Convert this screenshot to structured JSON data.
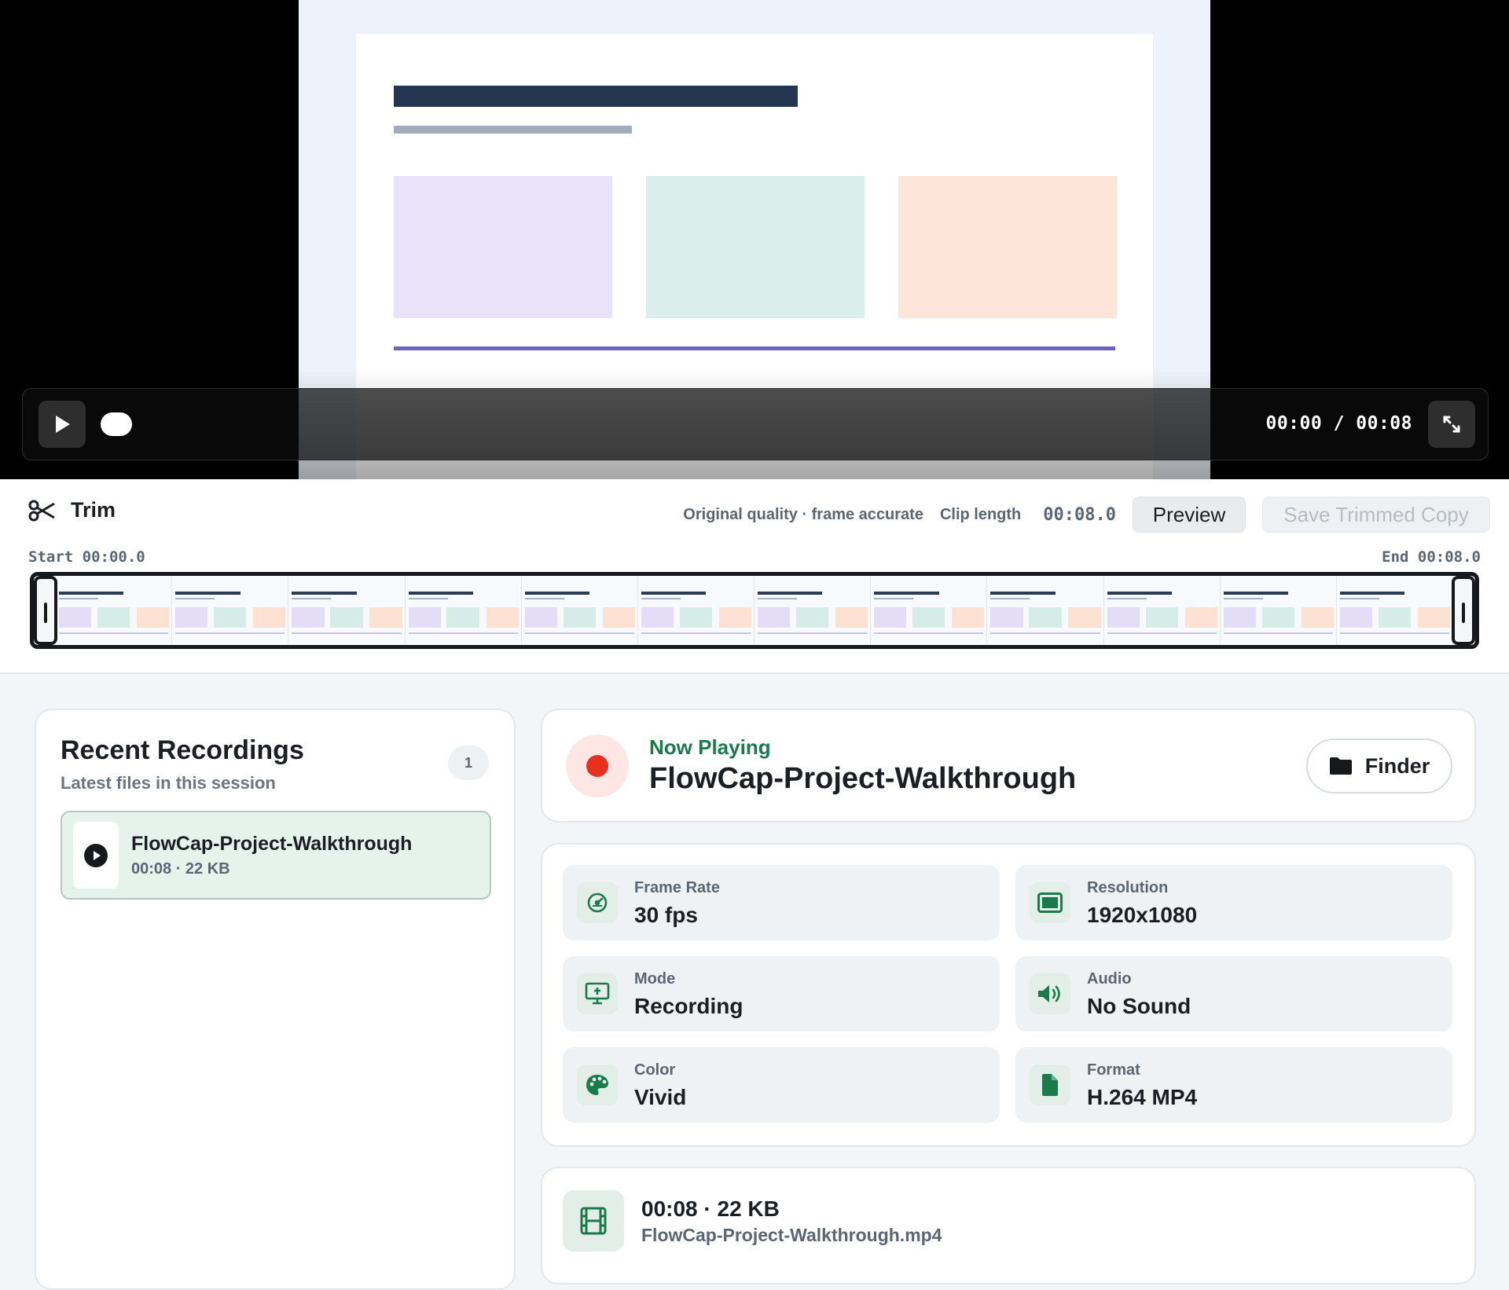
{
  "player": {
    "timecode": "00:00 / 00:08",
    "play_icon": "play-icon",
    "expand_icon": "expand-icon"
  },
  "trim": {
    "title": "Trim",
    "quality": "Original quality · frame accurate",
    "clip_length_label": "Clip length",
    "clip_length": "00:08.0",
    "preview_label": "Preview",
    "save_label": "Save Trimmed Copy",
    "start": "Start 00:00.0",
    "end": "End 00:08.0",
    "thumbnail_count": 12
  },
  "recent": {
    "title": "Recent Recordings",
    "subtitle": "Latest files in this session",
    "count": "1",
    "items": [
      {
        "name": "FlowCap-Project-Walkthrough",
        "meta": "00:08 · 22 KB"
      }
    ]
  },
  "now_playing": {
    "label": "Now Playing",
    "title": "FlowCap-Project-Walkthrough",
    "finder_label": "Finder"
  },
  "specs": [
    {
      "label": "Frame Rate",
      "value": "30 fps",
      "icon": "gauge-icon"
    },
    {
      "label": "Resolution",
      "value": "1920x1080",
      "icon": "screen-icon"
    },
    {
      "label": "Mode",
      "value": "Recording",
      "icon": "monitor-icon"
    },
    {
      "label": "Audio",
      "value": "No Sound",
      "icon": "speaker-icon"
    },
    {
      "label": "Color",
      "value": "Vivid",
      "icon": "palette-icon"
    },
    {
      "label": "Format",
      "value": "H.264 MP4",
      "icon": "file-icon"
    }
  ],
  "file": {
    "summary": "00:08 · 22 KB",
    "filename": "FlowCap-Project-Walkthrough.mp4"
  },
  "colors": {
    "accent_green": "#1b7a4c",
    "record_red": "#e8301f"
  }
}
